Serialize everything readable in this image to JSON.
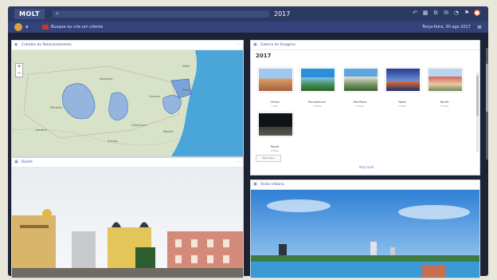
{
  "app": {
    "logo_text": "MOLT",
    "year": "2017"
  },
  "search": {
    "icon": "search-icon"
  },
  "top_icons": [
    "undo-icon",
    "grid-icon",
    "settings-icon",
    "message-icon",
    "bell-icon",
    "flag-icon",
    "user-icon"
  ],
  "subbar": {
    "crumb": "Busque ou crie um cliente",
    "date": "Terça-feira, 30 ago 2017"
  },
  "panels": {
    "map": {
      "title": "Cidades de Relacionamento"
    },
    "gallery": {
      "title": "Galeria de Imagens",
      "year": "2017",
      "items": [
        {
          "label": "Olinda",
          "sub": "1 foto"
        },
        {
          "label": "Pernambuco",
          "sub": "2 fotos"
        },
        {
          "label": "São Paulo",
          "sub": "5 fotos"
        },
        {
          "label": "Natal",
          "sub": "7 fotos"
        },
        {
          "label": "Recife",
          "sub": "3 fotos"
        },
        {
          "label": "Recife",
          "sub": "4 fotos"
        }
      ],
      "more_label": "Mais fotos",
      "see_all": "Veja tudo"
    },
    "photo": {
      "title": "Recife"
    },
    "photo2": {
      "title": "Visão Urbana"
    }
  },
  "map_labels": [
    "Recife",
    "Caruaru",
    "Petrolina",
    "Garanhuns",
    "Maceió",
    "Aracaju",
    "Juazeiro",
    "Salgueiro",
    "Natal"
  ],
  "colors": {
    "topbar": "#2c3a63",
    "accent": "#3e55a0",
    "map_land": "#d8e2c8",
    "map_sea": "#4aa5d8",
    "region": "#7fa6e6"
  }
}
